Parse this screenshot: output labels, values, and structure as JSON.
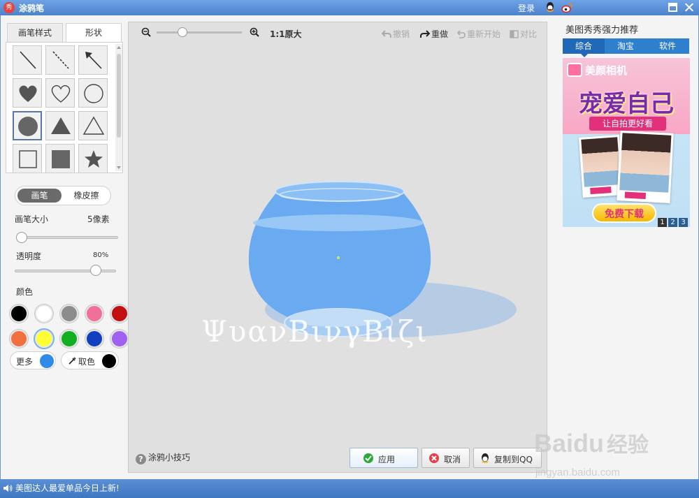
{
  "window": {
    "title": "涂鸦笔",
    "logo_text": "秀",
    "login_label": "登录"
  },
  "left_panel": {
    "tabs": [
      {
        "label": "画笔样式",
        "active": false
      },
      {
        "label": "形状",
        "active": true
      }
    ],
    "shapes": [
      "line",
      "dashed-line",
      "arrow",
      "heart-filled",
      "heart-outline",
      "circle-outline",
      "circle-filled",
      "triangle-filled",
      "triangle-outline",
      "square-outline",
      "square-filled",
      "star-filled"
    ],
    "selected_shape": "circle-filled",
    "mode": {
      "pen_label": "画笔",
      "eraser_label": "橡皮擦",
      "active": "pen"
    },
    "brush_size": {
      "label": "画笔大小",
      "value": "5像素",
      "fraction": 0.04
    },
    "opacity": {
      "label": "透明度",
      "value": "80%",
      "fraction": 0.8
    },
    "colors": {
      "label": "颜色",
      "swatches": [
        "#000000",
        "#ffffff",
        "#8c8c8c",
        "#f0709a",
        "#c01010",
        "#f07040",
        "#ffff33",
        "#10b020",
        "#1040c0",
        "#a060f0"
      ],
      "selected": "#ffff33",
      "more_label": "更多",
      "more_color": "#2f8ae8",
      "picker_label": "取色",
      "picker_color": "#000000"
    }
  },
  "canvas": {
    "zoom_label": "1:1原大",
    "zoom_fraction": 0.3,
    "toolbar": {
      "undo_label": "撤销",
      "redo_label": "重做",
      "restart_label": "重新开始",
      "compare_label": "对比"
    },
    "watermark_text": "ΨυανΒινγΒιζι",
    "tips_label": "涂鸦小技巧",
    "buttons": {
      "apply_label": "应用",
      "cancel_label": "取消",
      "copy_label": "复制到QQ"
    }
  },
  "right_panel": {
    "title": "美图秀秀强力推荐",
    "tabs": [
      {
        "label": "综合",
        "active": true
      },
      {
        "label": "淘宝",
        "active": false
      },
      {
        "label": "软件",
        "active": false
      }
    ],
    "ad": {
      "brand": "美颜相机",
      "slogan": "宠爱自己",
      "subtitle": "让自拍更好看",
      "download_label": "免费下载",
      "pages": [
        "1",
        "2",
        "3"
      ],
      "active_page": "1"
    }
  },
  "statusbar": {
    "message": "美图达人最爱单品今日上新!"
  },
  "overlay": {
    "baidu_logo": "Baidu",
    "baidu_jingyan": "经验",
    "baidu_url": "jingyan.baidu.com"
  }
}
